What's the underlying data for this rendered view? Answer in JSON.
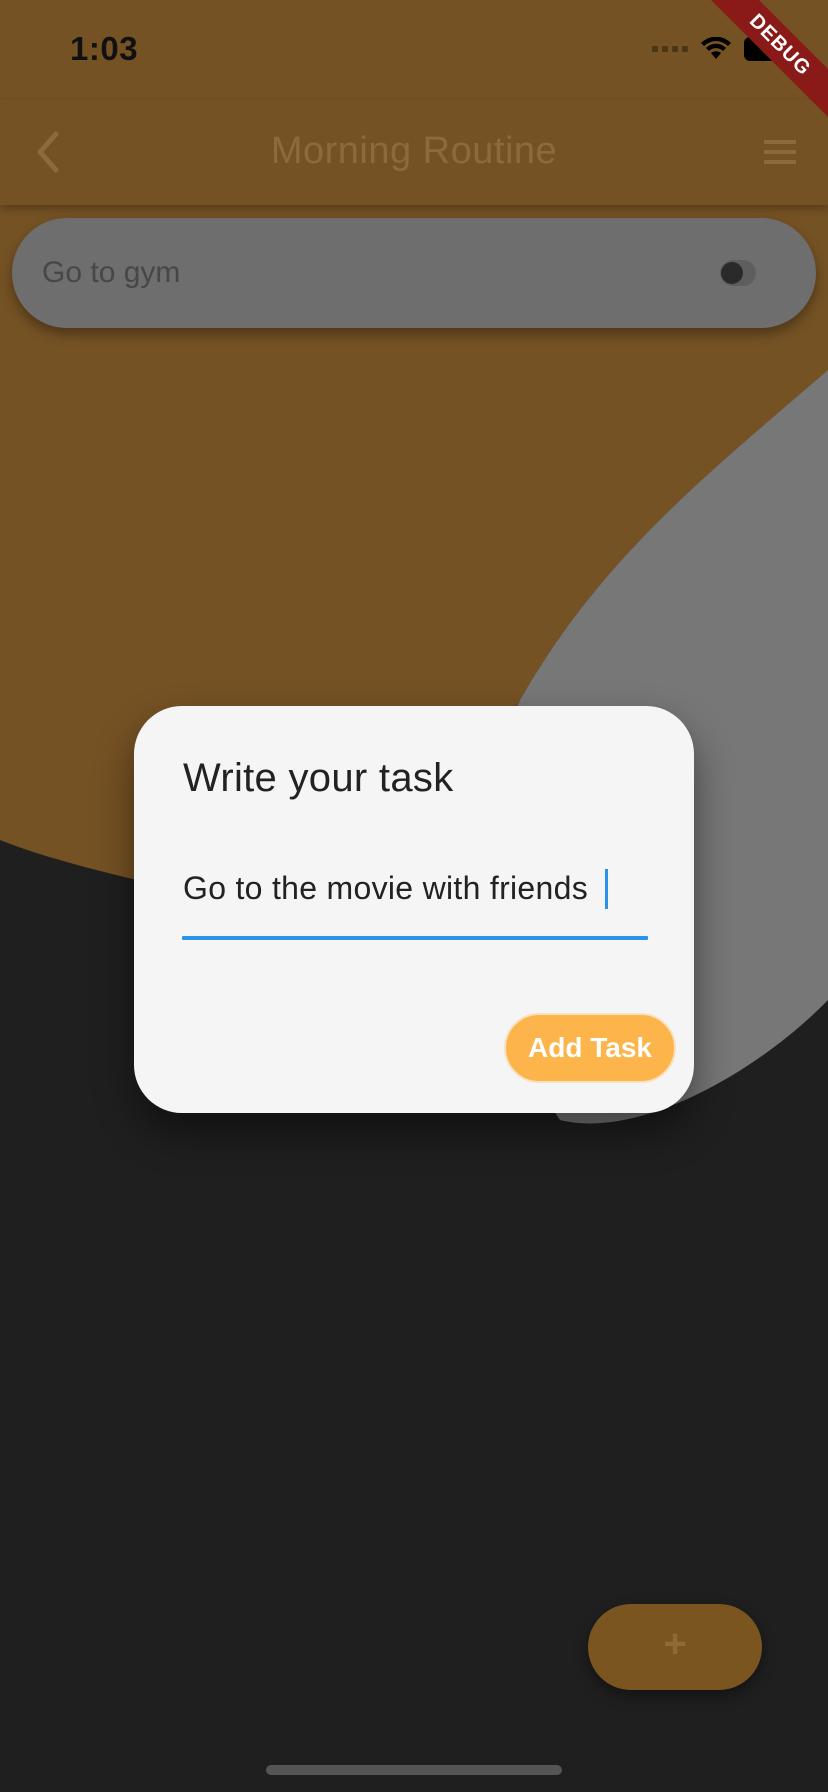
{
  "status_bar": {
    "time": "1:03",
    "wifi_icon": "wifi-icon",
    "battery_icon": "battery-icon"
  },
  "debug_banner": {
    "label": "DEBUG"
  },
  "app_bar": {
    "title": "Morning Routine",
    "back_icon": "chevron-left-icon",
    "menu_icon": "menu-icon"
  },
  "tasks": [
    {
      "label": "Go to gym",
      "toggle_icon": "toggle-icon"
    }
  ],
  "fab": {
    "label": "+"
  },
  "dialog": {
    "title": "Write your task",
    "input_value": "Go to the movie with friends",
    "add_button_label": "Add Task"
  },
  "colors": {
    "primary_orange": "#fdb44b",
    "input_focus_blue": "#2a95e8",
    "dialog_bg": "#f5f5f5",
    "dark_bg": "#1f1f1f",
    "debug_red": "#8a1a17"
  }
}
